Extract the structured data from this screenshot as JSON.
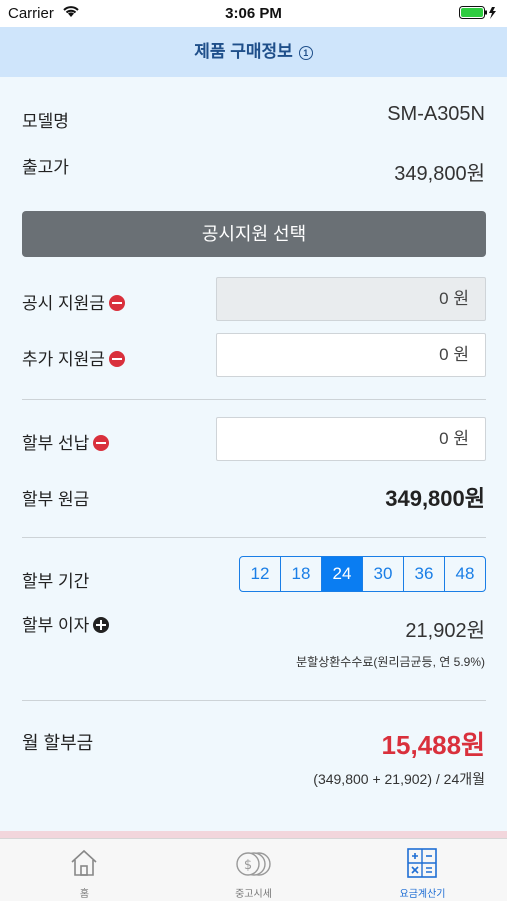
{
  "status": {
    "carrier": "Carrier",
    "time": "3:06 PM"
  },
  "nav": {
    "title": "제품 구매정보",
    "info_icon": "①"
  },
  "model": {
    "label": "모델명",
    "value": "SM-A305N"
  },
  "price": {
    "label": "출고가",
    "value": "349,800원"
  },
  "select_button": "공시지원 선택",
  "subsidy": {
    "label": "공시 지원금",
    "value": "0 원"
  },
  "extra_subsidy": {
    "label": "추가 지원금",
    "value": "0 원"
  },
  "prepay": {
    "label": "할부 선납",
    "value": "0 원"
  },
  "principal": {
    "label": "할부 원금",
    "value": "349,800원"
  },
  "period": {
    "label": "할부 기간",
    "options": [
      "12",
      "18",
      "24",
      "30",
      "36",
      "48"
    ],
    "selected": "24"
  },
  "interest": {
    "label": "할부 이자",
    "value": "21,902원",
    "note": "분할상환수수료(원리금균등, 연 5.9%)"
  },
  "monthly": {
    "label": "월 할부금",
    "value": "15,488원",
    "formula": "(349,800 + 21,902) / 24개월"
  },
  "tabs": [
    {
      "label": "홈",
      "icon": "home-icon"
    },
    {
      "label": "중고시세",
      "icon": "coins-icon"
    },
    {
      "label": "요금계산기",
      "icon": "calculator-icon"
    }
  ],
  "colors": {
    "accent": "#0a7df2",
    "monthly": "#d9303c",
    "nav_bg": "#cfe5fb"
  }
}
